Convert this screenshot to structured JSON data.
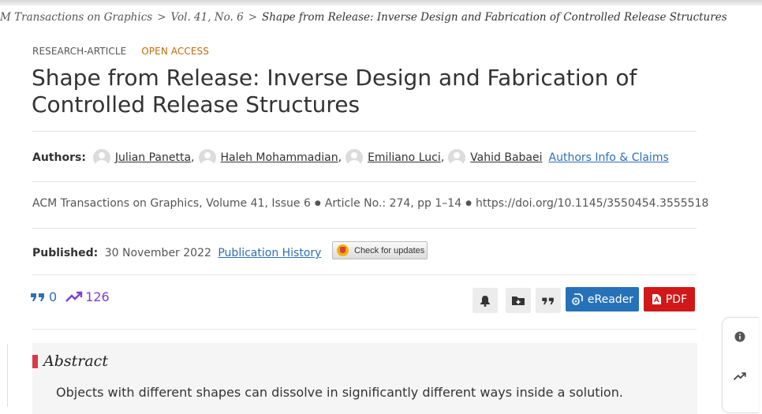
{
  "breadcrumb": {
    "journal": "M Transactions on Graphics",
    "sep1": ">",
    "volume": "Vol. 41, No. 6",
    "sep2": ">",
    "current": "Shape from Release: Inverse Design and Fabrication of Controlled Release Structures"
  },
  "tags": {
    "type": "RESEARCH-ARTICLE",
    "access": "OPEN ACCESS"
  },
  "title": "Shape from Release: Inverse Design and Fabrication of Controlled Release Structures",
  "authors": {
    "label": "Authors:",
    "names": [
      "Julian Panetta",
      "Haleh Mohammadian",
      "Emiliano Luci",
      "Vahid Babaei"
    ],
    "separator": ",",
    "info_link": "Authors Info & Claims"
  },
  "citation": {
    "journal": "ACM Transactions on Graphics",
    "volume": "Volume 41",
    "issue": "Issue 6",
    "article": "Article No.: 274, pp 1–14",
    "doi": "https://doi.org/10.1145/3550454.3555518",
    "bullet": "●"
  },
  "published": {
    "label": "Published:",
    "date": "30 November 2022",
    "history_link": "Publication History"
  },
  "check_updates": "Check for updates",
  "metrics": {
    "citations": "0",
    "downloads": "126"
  },
  "actions": {
    "icons": [
      "bell-icon",
      "folder-add-icon",
      "quote-icon"
    ],
    "ereader": "eReader",
    "pdf": "PDF"
  },
  "abstract": {
    "heading": "Abstract",
    "text": "Objects with different shapes can dissolve in significantly different ways inside a solution."
  },
  "rail": {
    "icons": [
      "info-icon",
      "trending-icon"
    ]
  },
  "colors": {
    "link": "#2d6fb3",
    "open_access": "#c06a0a",
    "ereader_bg": "#2672b8",
    "pdf_bg": "#d01818",
    "metric_downloads": "#7b3fd1",
    "abstract_accent": "#d93a4a"
  }
}
